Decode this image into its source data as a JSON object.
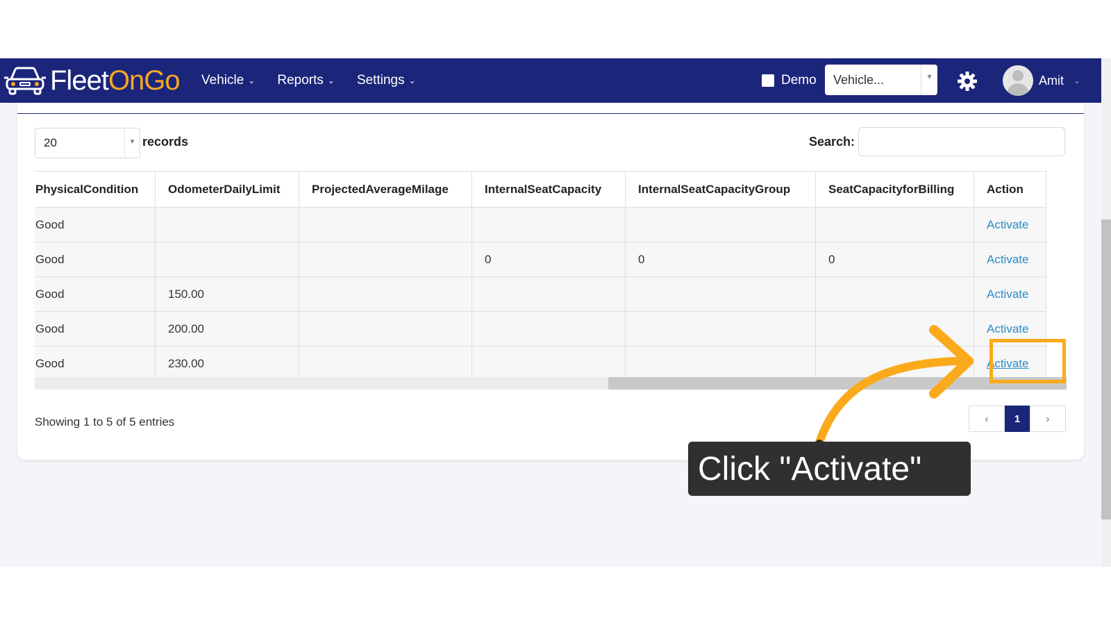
{
  "navbar": {
    "brand": {
      "part1": "Fleet",
      "part2": "OnGo"
    },
    "menu": [
      {
        "label": "Vehicle"
      },
      {
        "label": "Reports"
      },
      {
        "label": "Settings"
      }
    ],
    "demo_label": "Demo",
    "vehicle_select_value": "Vehicle...",
    "user_name": "Amit"
  },
  "controls": {
    "page_length": "20",
    "records_label": "records",
    "search_label": "Search:",
    "search_value": ""
  },
  "table": {
    "columns": [
      "PhysicalCondition",
      "OdometerDailyLimit",
      "ProjectedAverageMilage",
      "InternalSeatCapacity",
      "InternalSeatCapacityGroup",
      "SeatCapacityforBilling",
      "Action"
    ],
    "rows": [
      [
        "Good",
        "",
        "",
        "",
        "",
        "",
        "Activate"
      ],
      [
        "Good",
        "",
        "",
        "0",
        "0",
        "0",
        "Activate"
      ],
      [
        "Good",
        "150.00",
        "",
        "",
        "",
        "",
        "Activate"
      ],
      [
        "Good",
        "200.00",
        "",
        "",
        "",
        "",
        "Activate"
      ],
      [
        "Good",
        "230.00",
        "",
        "",
        "",
        "",
        "Activate"
      ]
    ]
  },
  "footer": {
    "info": "Showing 1 to 5 of 5 entries",
    "prev_glyph": "‹",
    "current_page": "1",
    "next_glyph": "›"
  },
  "tutorial": {
    "callout_text": "Click \"Activate\"",
    "accent_color": "#fbaa1c"
  },
  "colors": {
    "navbar_bg": "#1b267a",
    "brand_orange": "#f5a623",
    "link": "#2b8ac9"
  },
  "icons": [
    "car-logo-icon",
    "chevron-down-icon",
    "gear-icon",
    "user-avatar-icon",
    "dropdown-arrow-icon"
  ]
}
